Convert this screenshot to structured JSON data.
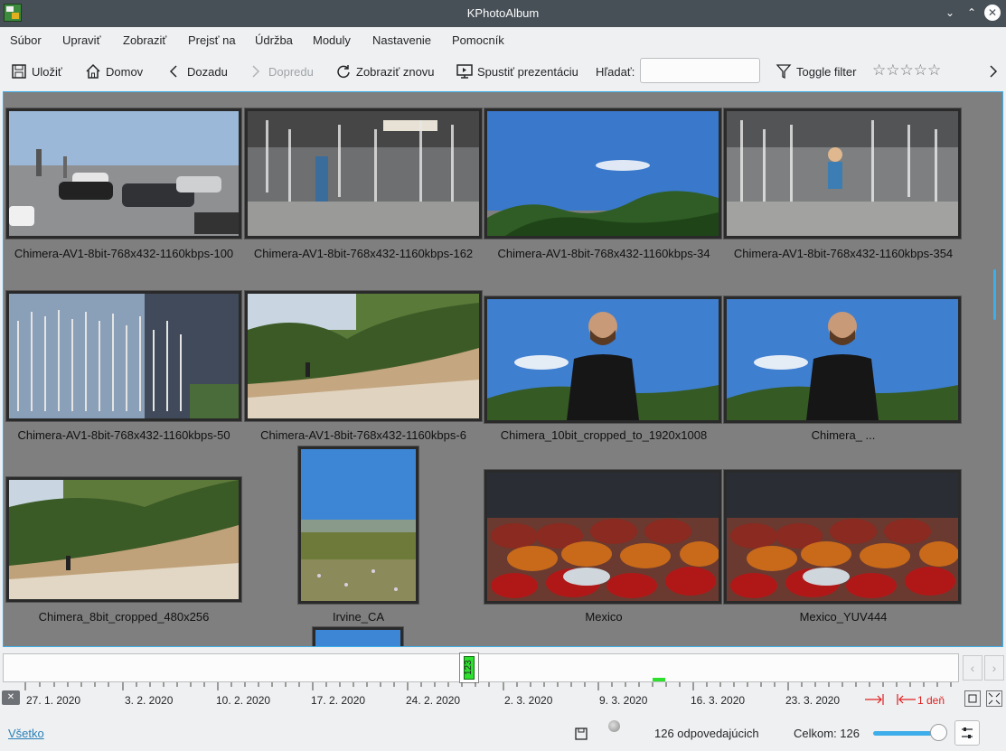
{
  "window": {
    "title": "KPhotoAlbum"
  },
  "menu": [
    "Súbor",
    "Upraviť",
    "Zobraziť",
    "Prejsť na",
    "Údržba",
    "Moduly",
    "Nastavenie",
    "Pomocník"
  ],
  "toolbar": {
    "save": "Uložiť",
    "home": "Domov",
    "back": "Dozadu",
    "forward": "Dopredu",
    "redisplay": "Zobraziť znovu",
    "slideshow": "Spustiť prezentáciu",
    "search_label": "Hľadať:",
    "search_value": "",
    "filter": "Toggle filter",
    "rating_stars": "☆☆☆☆☆"
  },
  "thumbnails": [
    {
      "caption": "Chimera-AV1-8bit-768x432-1160kbps-100"
    },
    {
      "caption": "Chimera-AV1-8bit-768x432-1160kbps-162"
    },
    {
      "caption": "Chimera-AV1-8bit-768x432-1160kbps-34"
    },
    {
      "caption": "Chimera-AV1-8bit-768x432-1160kbps-354"
    },
    {
      "caption": "Chimera-AV1-8bit-768x432-1160kbps-50"
    },
    {
      "caption": "Chimera-AV1-8bit-768x432-1160kbps-6"
    },
    {
      "caption": "Chimera_10bit_cropped_to_1920x1008"
    },
    {
      "caption": "Chimera_ ..."
    },
    {
      "caption": "Chimera_8bit_cropped_480x256"
    },
    {
      "caption": "Irvine_CA"
    },
    {
      "caption": "Mexico"
    },
    {
      "caption": "Mexico_YUV444"
    }
  ],
  "timeline": {
    "marker_count": "123",
    "dates": [
      "27. 1. 2020",
      "3. 2. 2020",
      "10. 2. 2020",
      "17. 2. 2020",
      "24. 2. 2020",
      "2. 3. 2020",
      "9. 3. 2020",
      "16. 3. 2020",
      "23. 3. 2020"
    ],
    "unit": "1 deň"
  },
  "status": {
    "all_link": "Všetko",
    "matching": "126 odpovedajúcich",
    "total": "Celkom: 126",
    "thumbnail_size": 0.88
  }
}
